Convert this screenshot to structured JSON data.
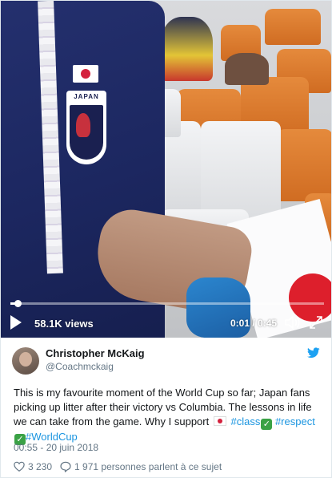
{
  "video": {
    "views": "58.1K views",
    "time": "0:01 / 0:45",
    "progress": 0.022,
    "icons": {
      "play": "play-icon",
      "volume": "volume-icon",
      "fullscreen": "expand-icon"
    },
    "crest_text": "JAPAN"
  },
  "tweet": {
    "author_name": "Christopher McKaig",
    "author_handle": "@Coachmckaig",
    "text_line1": "This is my favourite moment of the World Cup so far; Japan fans picking up litter after their victory vs Columbia. The lessons in life we can take from the game. Why I support ",
    "hashtag_class": "#class",
    "hashtag_respect": "#respect",
    "hashtag_worldcup": "#WorldCup",
    "date": "00:55 - 20 juin 2018",
    "likes": "3 230",
    "replies_text": "1 971 personnes parlent à ce sujet",
    "brand_color": "#1da1f2",
    "link_color": "#1b95e0"
  }
}
